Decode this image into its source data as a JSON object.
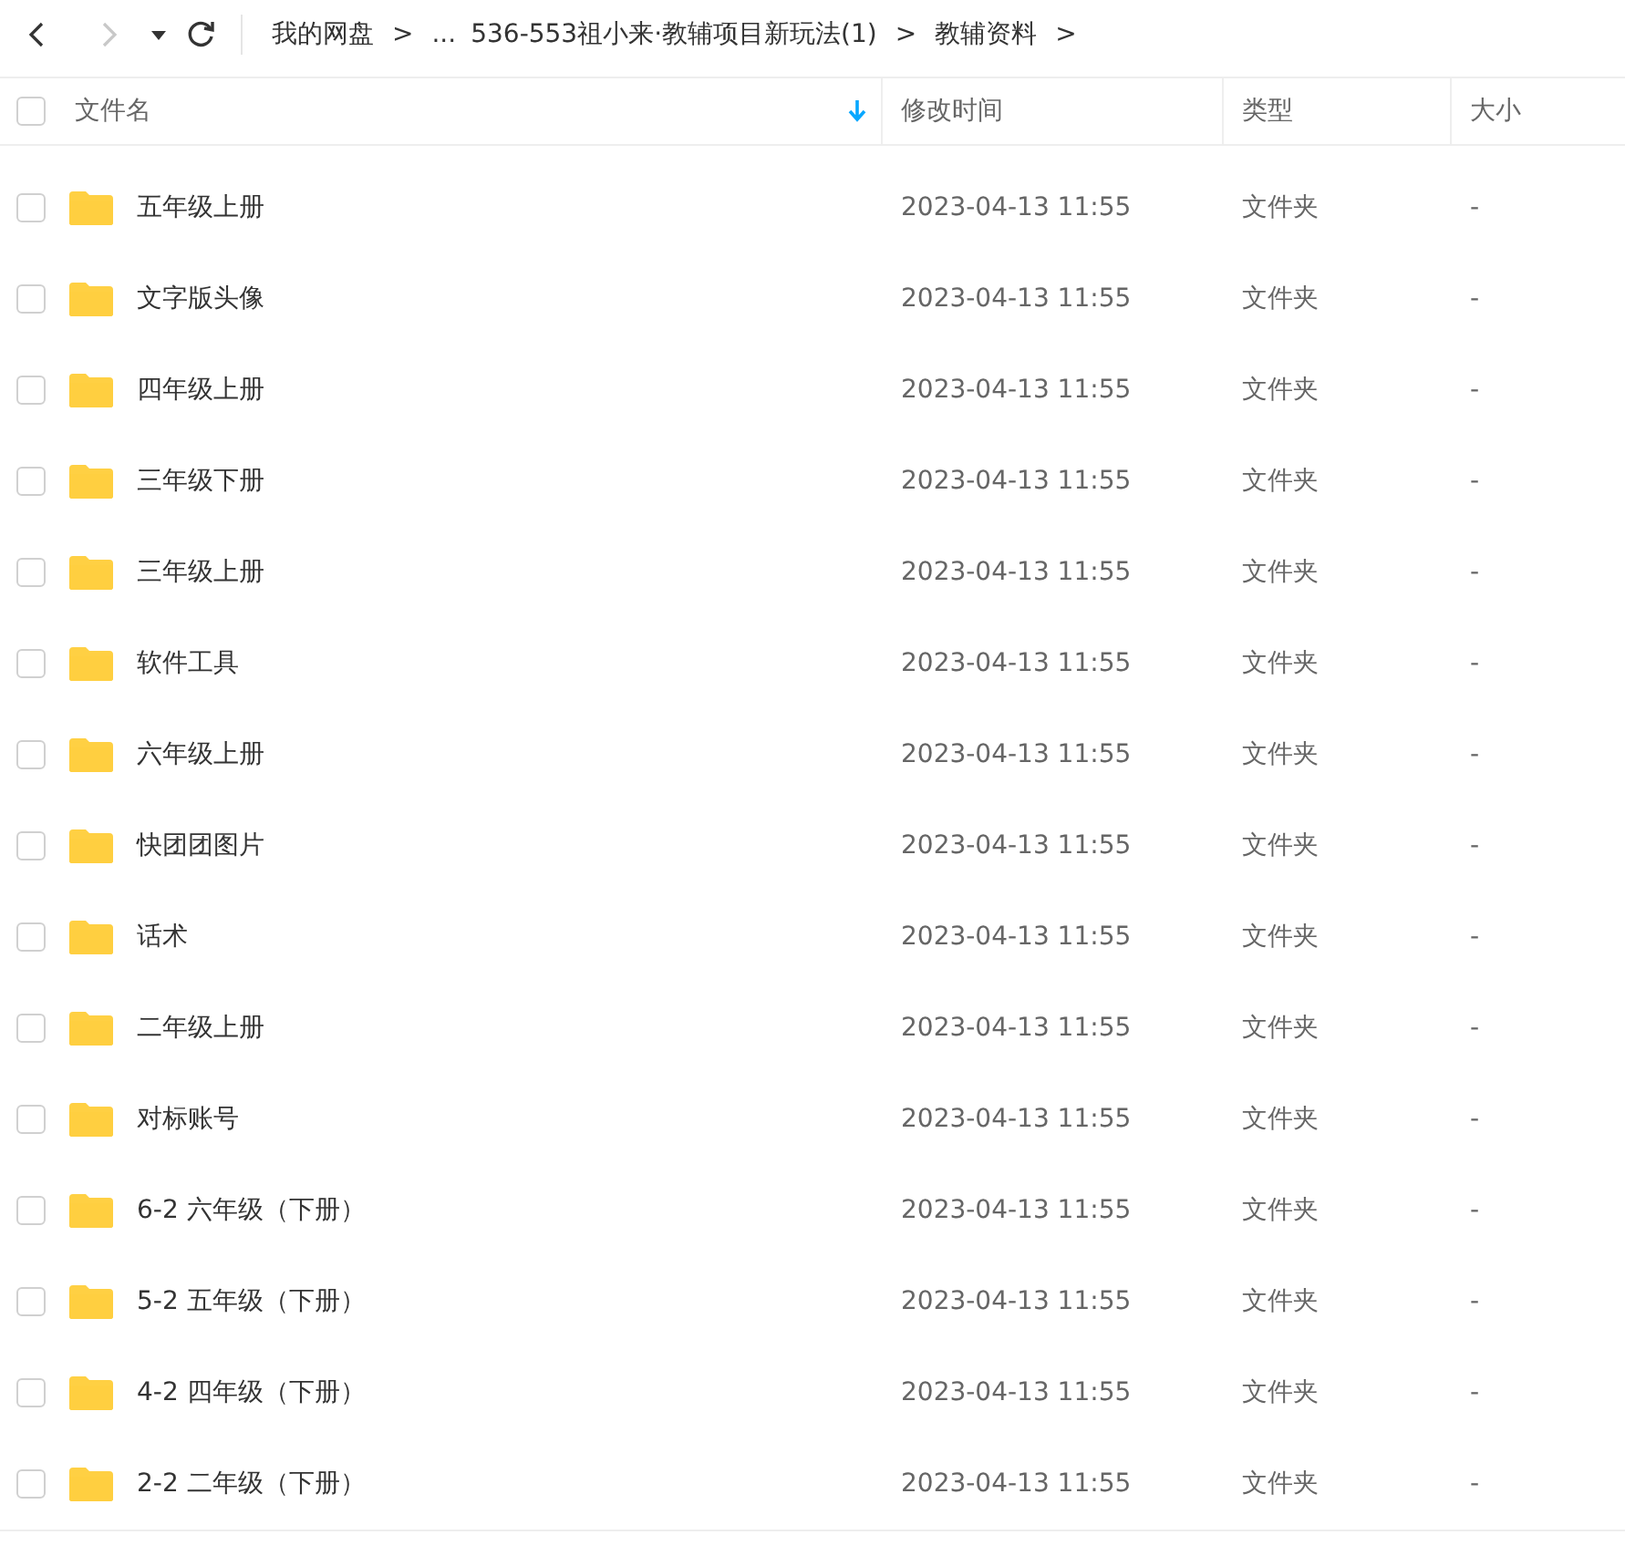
{
  "nav": {
    "back_disabled": false,
    "forward_disabled": true
  },
  "breadcrumb": [
    {
      "label": "我的网盘",
      "separator": ">"
    },
    {
      "label": "..."
    },
    {
      "label": "536-553祖小来·教辅项目新玩法(1)",
      "separator": ">"
    },
    {
      "label": "教辅资料",
      "separator": ">"
    }
  ],
  "select_all": {
    "checked": false
  },
  "columns": [
    {
      "label": "文件名",
      "sorted": true
    },
    {
      "label": "修改时间",
      "sorted": false
    },
    {
      "label": "类型",
      "sorted": false
    },
    {
      "label": "大小",
      "sorted": false
    }
  ],
  "rows": [
    {
      "name": "五年级上册",
      "modified": "2023-04-13 11:55",
      "type": "文件夹",
      "size": "-",
      "checked": false
    },
    {
      "name": "文字版头像",
      "modified": "2023-04-13 11:55",
      "type": "文件夹",
      "size": "-",
      "checked": false
    },
    {
      "name": "四年级上册",
      "modified": "2023-04-13 11:55",
      "type": "文件夹",
      "size": "-",
      "checked": false
    },
    {
      "name": "三年级下册",
      "modified": "2023-04-13 11:55",
      "type": "文件夹",
      "size": "-",
      "checked": false
    },
    {
      "name": "三年级上册",
      "modified": "2023-04-13 11:55",
      "type": "文件夹",
      "size": "-",
      "checked": false
    },
    {
      "name": "软件工具",
      "modified": "2023-04-13 11:55",
      "type": "文件夹",
      "size": "-",
      "checked": false
    },
    {
      "name": "六年级上册",
      "modified": "2023-04-13 11:55",
      "type": "文件夹",
      "size": "-",
      "checked": false
    },
    {
      "name": "快团团图片",
      "modified": "2023-04-13 11:55",
      "type": "文件夹",
      "size": "-",
      "checked": false
    },
    {
      "name": "话术",
      "modified": "2023-04-13 11:55",
      "type": "文件夹",
      "size": "-",
      "checked": false
    },
    {
      "name": "二年级上册",
      "modified": "2023-04-13 11:55",
      "type": "文件夹",
      "size": "-",
      "checked": false
    },
    {
      "name": "对标账号",
      "modified": "2023-04-13 11:55",
      "type": "文件夹",
      "size": "-",
      "checked": false
    },
    {
      "name": "6-2 六年级（下册）",
      "modified": "2023-04-13 11:55",
      "type": "文件夹",
      "size": "-",
      "checked": false
    },
    {
      "name": "5-2 五年级（下册）",
      "modified": "2023-04-13 11:55",
      "type": "文件夹",
      "size": "-",
      "checked": false
    },
    {
      "name": "4-2 四年级（下册）",
      "modified": "2023-04-13 11:55",
      "type": "文件夹",
      "size": "-",
      "checked": false
    },
    {
      "name": "2-2 二年级（下册）",
      "modified": "2023-04-13 11:55",
      "type": "文件夹",
      "size": "-",
      "checked": false
    }
  ]
}
